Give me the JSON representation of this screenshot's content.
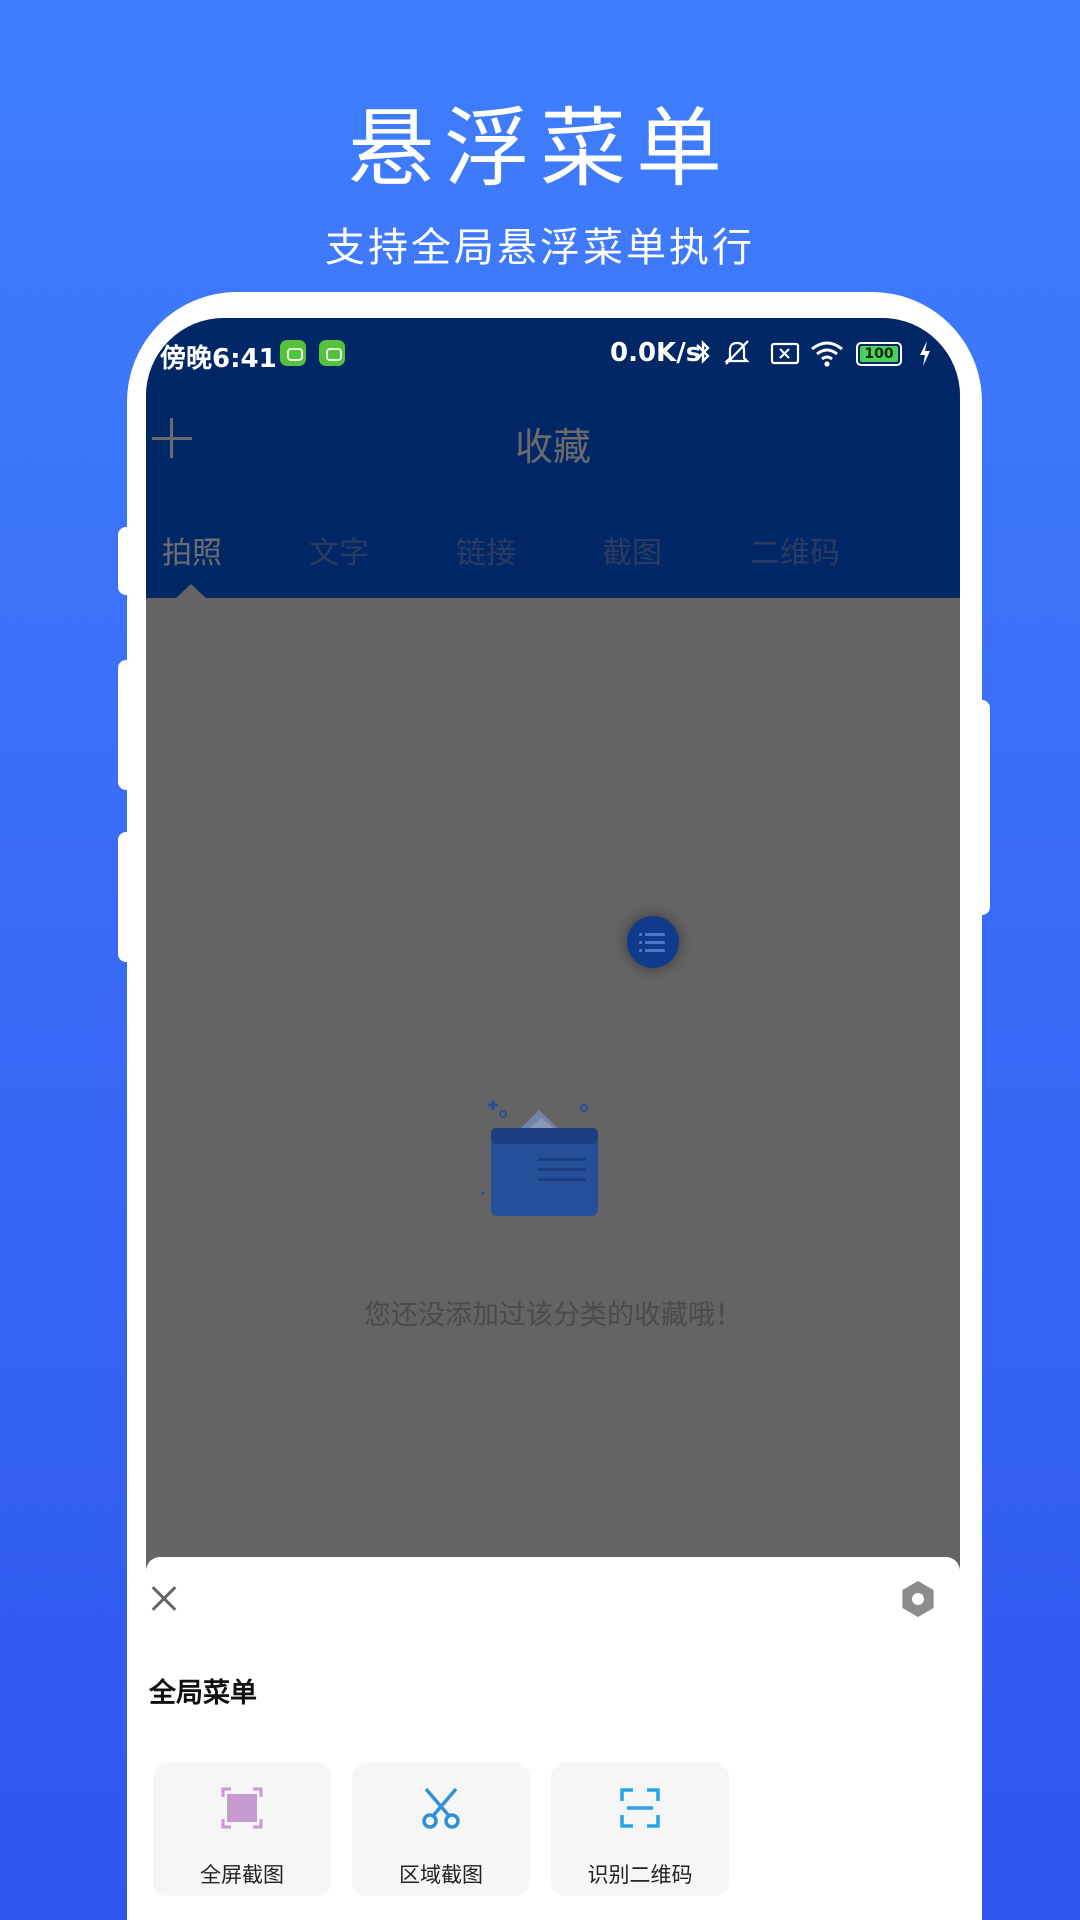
{
  "promo": {
    "headline": "悬浮菜单",
    "subline": "支持全局悬浮菜单执行"
  },
  "status_bar": {
    "time": "傍晚6:41",
    "speed": "0.0K/s",
    "battery": "100"
  },
  "app": {
    "title": "收藏",
    "tabs": [
      "拍照",
      "文字",
      "链接",
      "截图",
      "二维码"
    ],
    "active_tab": "拍照",
    "empty_message": "您还没添加过该分类的收藏哦！"
  },
  "sheet": {
    "title": "全局菜单",
    "actions": [
      {
        "label": "全屏截图",
        "icon": "fullscreen-screenshot-icon",
        "color": "#c79ad0"
      },
      {
        "label": "区域截图",
        "icon": "scissors-icon",
        "color": "#2f8fd8"
      },
      {
        "label": "识别二维码",
        "icon": "scan-qrcode-icon",
        "color": "#2aa4e6"
      }
    ]
  },
  "colors": {
    "background_top": "#3f7ffd",
    "background_bottom": "#2f56ef",
    "app_header": "#022767",
    "overlay": "#646464"
  }
}
